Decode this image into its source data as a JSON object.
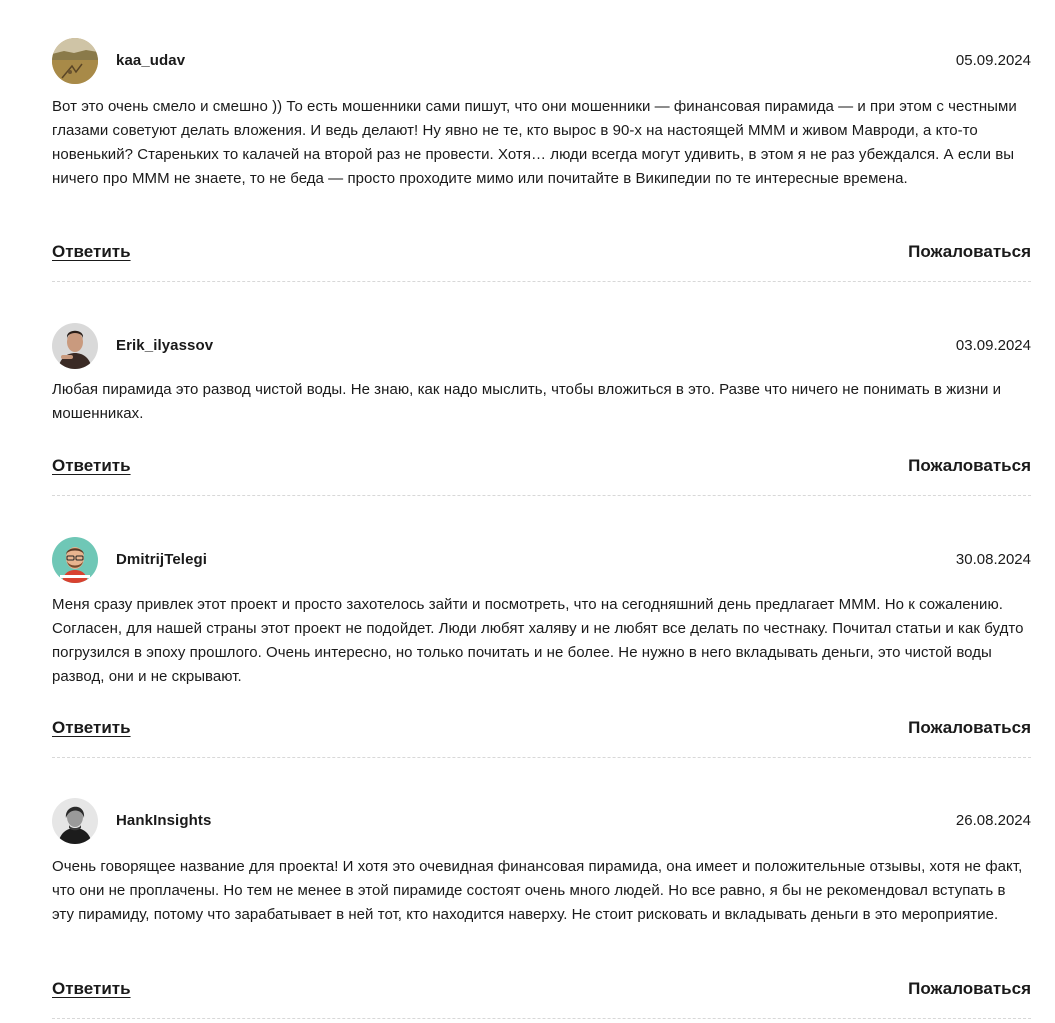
{
  "actions": {
    "reply_label": "Ответить",
    "report_label": "Пожаловаться"
  },
  "comments": [
    {
      "author": "kaa_udav",
      "date": "05.09.2024",
      "text": "Вот это очень смело и смешно )) То есть мошенники сами пишут, что они мошенники — финансовая пирамида — и при этом с честными глазами советуют делать вложения. И ведь делают! Ну явно не те, кто вырос в 90-х на настоящей МММ и живом Мавроди, а кто-то новенький? Стареньких то калачей на второй раз не провести. Хотя… люди всегда могут удивить, в этом я не раз убеждался. А если вы ничего про МММ не знаете, то не беда — просто проходите мимо или почитайте в Википедии по те интересные времена.",
      "avatar_icon": "landscape-photo-avatar"
    },
    {
      "author": "Erik_ilyassov",
      "date": "03.09.2024",
      "text": "Любая пирамида это развод чистой воды. Не знаю, как надо мыслить, чтобы вложиться в это. Разве что ничего не понимать в жизни и мошенниках.",
      "avatar_icon": "person-photo-avatar"
    },
    {
      "author": "DmitrijTelegi",
      "date": "30.08.2024",
      "text": "Меня сразу привлек этот проект и просто захотелось зайти и посмотреть, что на сегодняшний день предлагает МММ. Но к сожалению. Согласен, для нашей страны этот проект не подойдет. Люди любят халяву и не любят все делать по честнаку. Почитал статьи и как будто погрузился в эпоху прошлого. Очень интересно, но только почитать и не более. Не нужно в него вкладывать деньги, это чистой воды развод, они и не скрывают.",
      "avatar_icon": "cartoon-man-avatar"
    },
    {
      "author": "HankInsights",
      "date": "26.08.2024",
      "text": "Очень говорящее название для проекта! И хотя это очевидная финансовая пирамида, она имеет и положительные отзывы, хотя не факт, что они не проплачены. Но тем не менее в этой пирамиде состоят очень много людей. Но все равно, я бы не рекомендовал вступать в эту пирамиду, потому что зарабатывает в ней тот, кто находится наверху. Не стоит рисковать и вкладывать деньги в это мероприятие.",
      "avatar_icon": "bw-portrait-avatar"
    }
  ]
}
